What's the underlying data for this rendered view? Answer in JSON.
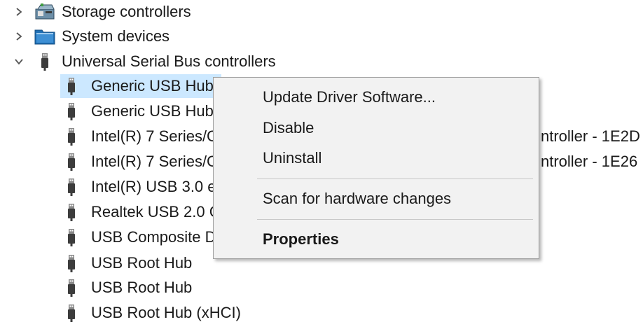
{
  "tree": {
    "categories": [
      {
        "label": "Storage controllers",
        "expanded": false,
        "icon": "storage-controller-icon"
      },
      {
        "label": "System devices",
        "expanded": false,
        "icon": "system-devices-icon"
      },
      {
        "label": "Universal Serial Bus controllers",
        "expanded": true,
        "icon": "usb-plug-icon"
      }
    ],
    "usb_children": [
      {
        "label": "Generic USB Hub",
        "selected": true
      },
      {
        "label": "Generic USB Hub"
      },
      {
        "label": "Intel(R) 7 Series/C"
      },
      {
        "label": "Intel(R) 7 Series/C"
      },
      {
        "label": "Intel(R) USB 3.0 e"
      },
      {
        "label": "Realtek USB 2.0 C"
      },
      {
        "label": "USB Composite D"
      },
      {
        "label": "USB Root Hub"
      },
      {
        "label": "USB Root Hub"
      },
      {
        "label": "USB Root Hub (xHCI)"
      }
    ],
    "overflow_suffixes": [
      "ntroller - 1E2D",
      "ntroller - 1E26"
    ]
  },
  "context_menu": {
    "items": [
      {
        "label": "Update Driver Software...",
        "bold": false
      },
      {
        "label": "Disable",
        "bold": false
      },
      {
        "label": "Uninstall",
        "bold": false
      },
      {
        "label": "Scan for hardware changes",
        "bold": false
      },
      {
        "label": "Properties",
        "bold": true
      }
    ]
  },
  "colors": {
    "selection": "#cce8ff",
    "menu_background": "#f2f2f2",
    "menu_border": "#a0a0a0",
    "text": "#1a1a1a"
  }
}
